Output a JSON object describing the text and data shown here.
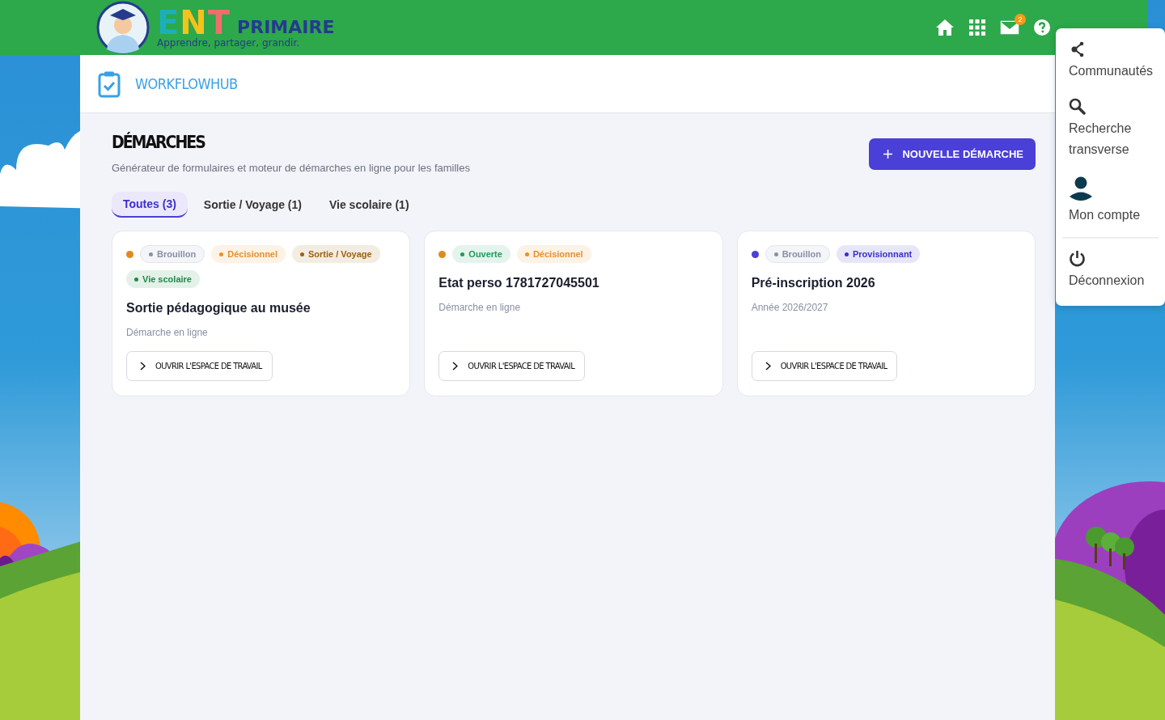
{
  "header": {
    "logo": {
      "word": "ENT",
      "level": "PRIMAIRE",
      "tagline": "Apprendre, partager, grandir."
    },
    "mail_badge": "2"
  },
  "app": {
    "title": "WORKFLOWHUB"
  },
  "page": {
    "title": "DÉMARCHES",
    "subtitle": "Générateur de formulaires et moteur de démarches en ligne pour les familles",
    "new_button": "NOUVELLE DÉMARCHE"
  },
  "tabs": [
    {
      "label": "Toutes (3)",
      "selected": true
    },
    {
      "label": "Sortie / Voyage (1)",
      "selected": false
    },
    {
      "label": "Vie scolaire (1)",
      "selected": false
    }
  ],
  "cards": [
    {
      "color": "#e08a1e",
      "tags": [
        {
          "label": "Brouillon",
          "color": "#8a8fa3"
        },
        {
          "label": "Décisionnel",
          "color": "#e8902a"
        },
        {
          "label": "Sortie / Voyage",
          "color": "#a0600f"
        },
        {
          "label": "Vie scolaire",
          "color": "#1e8a4a"
        }
      ],
      "title": "Sortie pédagogique au musée",
      "subtitle": "Démarche en ligne",
      "button": "OUVRIR L'ESPACE DE TRAVAIL"
    },
    {
      "color": "#e08a1e",
      "tags": [
        {
          "label": "Ouverte",
          "color": "#1e9a5a"
        },
        {
          "label": "Décisionnel",
          "color": "#e8902a"
        }
      ],
      "title": "Etat perso 1781727045501",
      "subtitle": "Démarche en ligne",
      "button": "OUVRIR L'ESPACE DE TRAVAIL"
    },
    {
      "color": "#4a3fd6",
      "tags": [
        {
          "label": "Brouillon",
          "color": "#8a8fa3"
        },
        {
          "label": "Provisionnant",
          "color": "#3b2fc9"
        }
      ],
      "title": "Pré-inscription 2026",
      "subtitle": "Année 2026/2027",
      "button": "OUVRIR L'ESPACE DE TRAVAIL"
    }
  ],
  "user_menu": [
    {
      "label": "Communautés"
    },
    {
      "label": "Recherche transverse"
    },
    {
      "label": "Mon compte"
    },
    {
      "label": "Déconnexion"
    }
  ]
}
